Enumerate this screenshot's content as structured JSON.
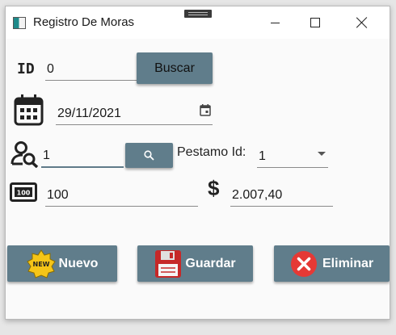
{
  "window": {
    "title": "Registro De Moras"
  },
  "form": {
    "id_label": "ID",
    "id_value": "0",
    "buscar_label": "Buscar",
    "date_value": "29/11/2021",
    "prestamo_search_value": "1",
    "prestamo_id_label": "Pestamo Id:",
    "prestamo_id_selected": "1",
    "amount_value": "100",
    "currency_symbol": "$",
    "total_value": "2.007,40"
  },
  "actions": {
    "nuevo_label": "Nuevo",
    "guardar_label": "Guardar",
    "eliminar_label": "Eliminar",
    "new_badge_text": "NEW"
  },
  "colors": {
    "button_bg": "#607d8b",
    "focus_underline": "#5f7a89",
    "eliminar_icon": "#e53935",
    "guardar_icon": "#c62828",
    "new_badge": "#f5c518"
  },
  "icons": {
    "id": "id-badge-icon",
    "date": "calendar-icon",
    "date_picker": "calendar-small-icon",
    "person_search": "person-search-icon",
    "search": "search-icon",
    "money": "money-bill-icon",
    "dollar": "dollar-icon",
    "new": "new-badge-icon",
    "save": "floppy-disk-icon",
    "delete": "delete-circle-icon"
  }
}
